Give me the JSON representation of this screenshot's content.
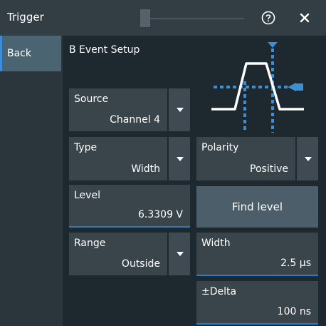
{
  "window": {
    "title": "Trigger"
  },
  "sidebar": {
    "back_label": "Back"
  },
  "section": {
    "title": "B Event Setup"
  },
  "source": {
    "label": "Source",
    "value": "Channel 4"
  },
  "type": {
    "label": "Type",
    "value": "Width"
  },
  "polarity": {
    "label": "Polarity",
    "value": "Positive"
  },
  "level": {
    "label": "Level",
    "value": "6.3309 V"
  },
  "find_level": {
    "label": "Find level"
  },
  "range": {
    "label": "Range",
    "value": "Outside"
  },
  "width": {
    "label": "Width",
    "value": "2.5 µs"
  },
  "delta": {
    "label": "±Delta",
    "value": "100 ns"
  },
  "colors": {
    "accent": "#2c7fbf",
    "marker": "#3f8fd0"
  },
  "icons": [
    "help-icon",
    "close-icon",
    "chevron-down-icon"
  ]
}
